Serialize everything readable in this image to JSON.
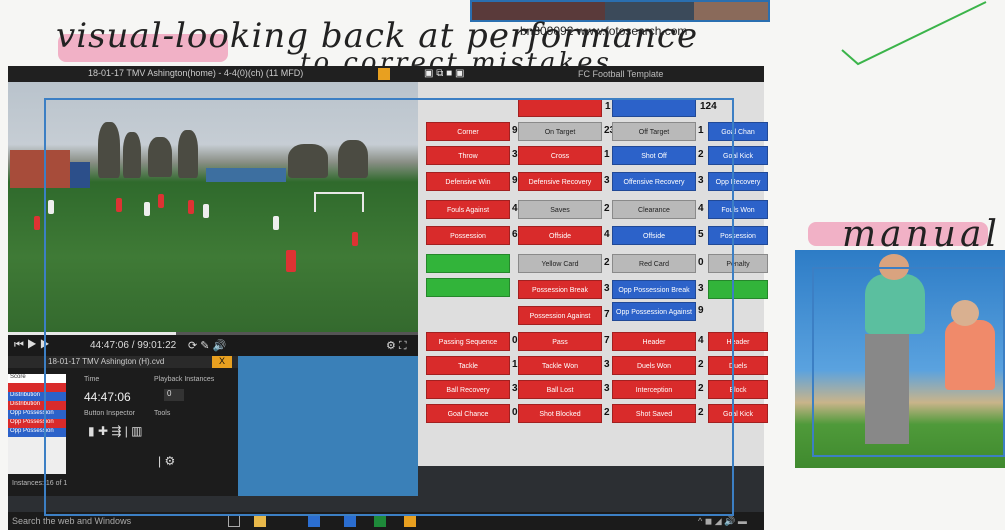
{
  "top": {
    "watermark": "bn309092 www.fotosearch.com"
  },
  "handwriting": {
    "line1": "visual-looking back at performance",
    "line2": "to correct mistakes",
    "side_label": "manual"
  },
  "video_window": {
    "title": "18-01-17 TMV Ashington(home) - 4-4(0)(ch) (11 MFD)",
    "time_display": "44:47:06 / 99:01:22",
    "progress_fraction": 0.41
  },
  "small_panel": {
    "title": "18-01-17 TMV Ashington (H).cvd",
    "close": "X",
    "list_items": [
      "Score",
      "Distribution",
      "Distribution",
      "Opp Possession",
      "Opp Possession",
      "Opp Possession"
    ],
    "time_label": "Time",
    "playback_label": "Playback Instances",
    "playback_value": "0",
    "time_value": "44:47:06",
    "button_label": "Button Inspector",
    "tools_label": "Tools",
    "footer": "Instances: 16 of 1"
  },
  "tag_panel": {
    "title": "FC Football Template",
    "header_total": "124",
    "rows": [
      {
        "col_a": {
          "label": "Corner",
          "count": "9"
        },
        "col_b": {
          "label": "On Target",
          "count": "23"
        },
        "col_c": {
          "label": "Off Target",
          "count": "1"
        },
        "col_d": {
          "label": "Goal Chan"
        }
      },
      {
        "col_a": {
          "label": "Throw",
          "count": "3"
        },
        "col_b": {
          "label": "Cross",
          "count": "1"
        },
        "col_c": {
          "label": "Shot Off",
          "count": "2"
        },
        "col_d": {
          "label": "Goal Kick"
        }
      },
      {
        "col_a": {
          "label": "Defensive Win",
          "count": "9"
        },
        "col_b": {
          "label": "Defensive Recovery",
          "count": "3"
        },
        "col_c": {
          "label": "Offensive Recovery",
          "count": "3"
        },
        "col_d": {
          "label": "Opp Recovery"
        }
      },
      {
        "col_a": {
          "label": "Fouls Against",
          "count": "4"
        },
        "col_b": {
          "label": "Saves",
          "count": "2"
        },
        "col_c": {
          "label": "Clearance",
          "count": "4"
        },
        "col_d": {
          "label": "Fouls Won"
        }
      },
      {
        "col_a": {
          "label": "Possession",
          "count": "6"
        },
        "col_b": {
          "label": "Offside",
          "count": "4"
        },
        "col_c": {
          "label": "Offside",
          "count": "5"
        },
        "col_d": {
          "label": "Possession"
        }
      },
      {
        "col_b": {
          "label": "Yellow Card",
          "count": "2"
        },
        "col_c": {
          "label": "Red Card",
          "count": "0"
        },
        "col_d": {
          "label": "Penalty"
        }
      }
    ],
    "row6_b": {
      "label": "Possession Break",
      "count": "3"
    },
    "row6_c": {
      "label": "Opp Possession Break",
      "count": "3"
    },
    "row7_b": {
      "label": "Possession Against",
      "count": "7"
    },
    "row7_c": {
      "label": "Opp Possession Against",
      "count": "9"
    },
    "bottom_rows": [
      {
        "a": {
          "label": "Passing Sequence",
          "count": "0"
        },
        "b": {
          "label": "Pass",
          "count": "7"
        },
        "c": {
          "label": "Header",
          "count": "4"
        },
        "d": {
          "label": "Header"
        }
      },
      {
        "a": {
          "label": "Tackle",
          "count": "1"
        },
        "b": {
          "label": "Tackle Won",
          "count": "3"
        },
        "c": {
          "label": "Duels Won",
          "count": "2"
        },
        "d": {
          "label": "Duels"
        }
      },
      {
        "a": {
          "label": "Ball Recovery",
          "count": "3"
        },
        "b": {
          "label": "Ball Lost",
          "count": "3"
        },
        "c": {
          "label": "Interception",
          "count": "2"
        },
        "d": {
          "label": "Block"
        }
      },
      {
        "a": {
          "label": "Goal Chance",
          "count": "0"
        },
        "b": {
          "label": "Shot Blocked",
          "count": "2"
        },
        "c": {
          "label": "Shot Saved",
          "count": "2"
        },
        "d": {
          "label": "Goal Kick"
        }
      }
    ]
  },
  "taskbar": {
    "search": "Search the web and Windows"
  },
  "colors": {
    "red": "#d92b2b",
    "blue": "#2c62c9",
    "grey": "#b9b9b9",
    "green": "#32b43a",
    "outline": "#3c7fc4"
  }
}
